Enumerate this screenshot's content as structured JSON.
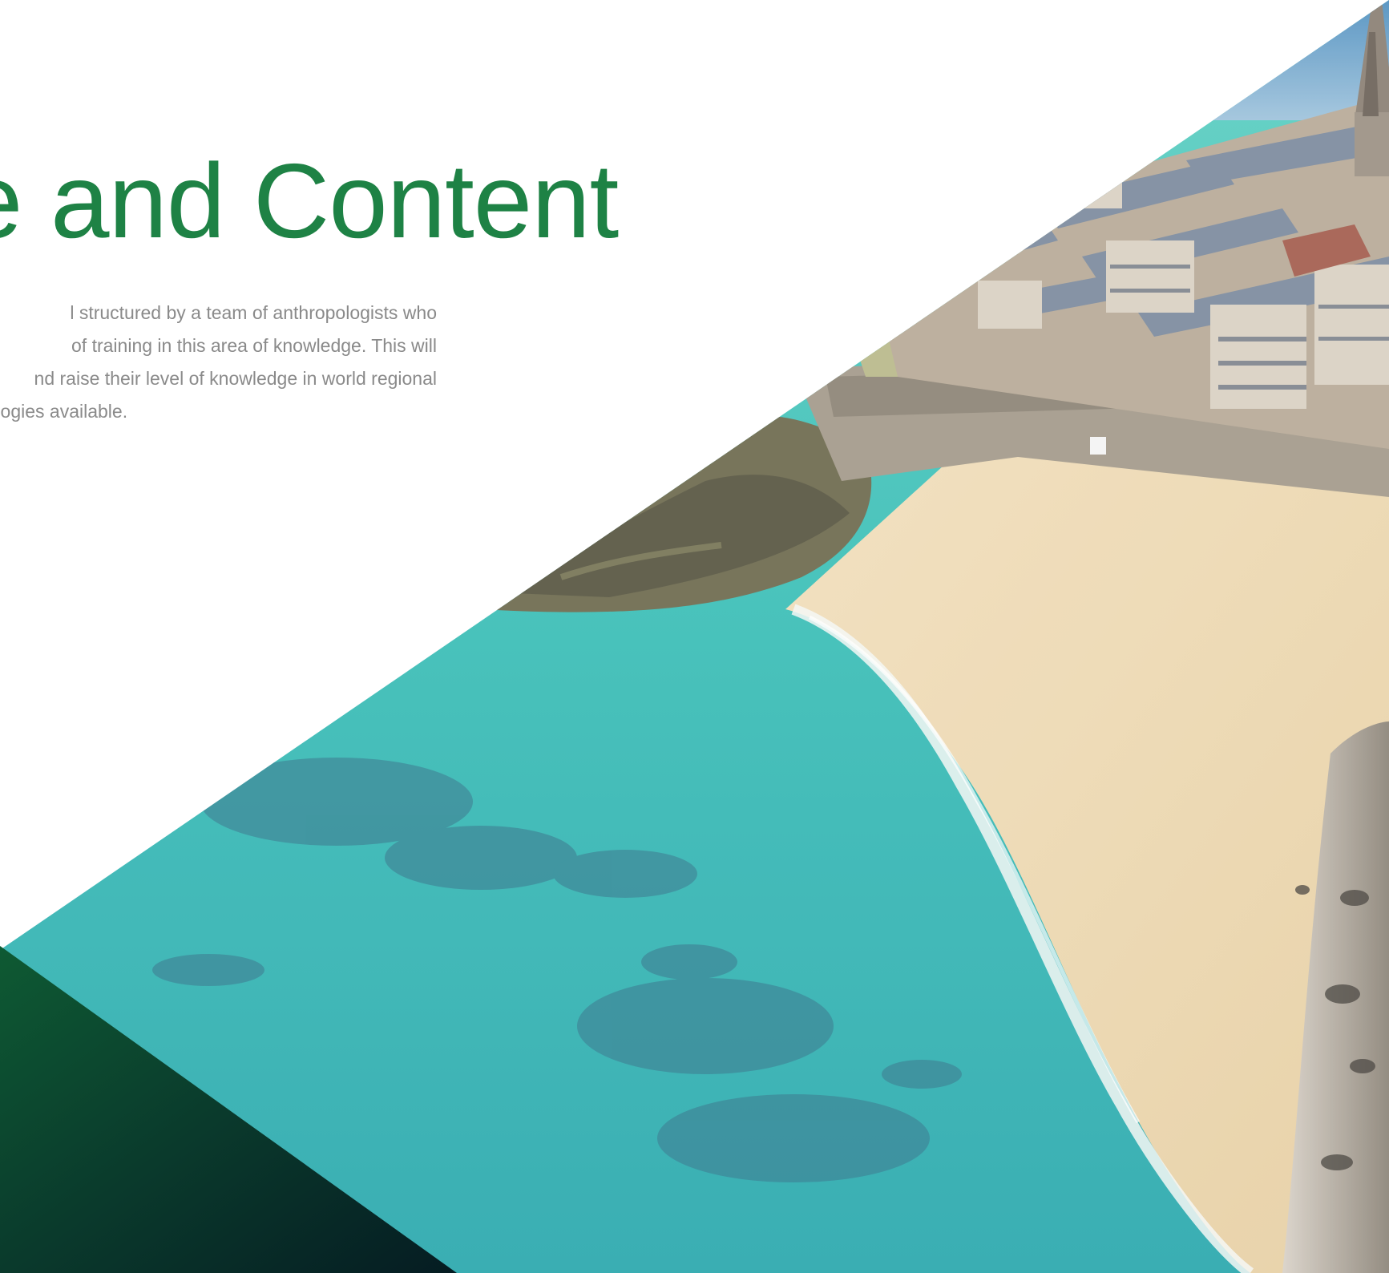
{
  "section": {
    "heading": "re and Content",
    "body_lines": [
      "l structured by a team of anthropologists who",
      "of training in this area of knowledge. This will",
      "nd raise their level of knowledge in world regional",
      "tional technologies available."
    ]
  },
  "image": {
    "subject": "aerial view of walled coastal town with sandy beach and turquoise sea"
  },
  "colors": {
    "heading": "#1e8245",
    "body_text": "#8a8a8a",
    "background": "#ffffff",
    "sea": "#3fc0b8",
    "sand": "#ecd9b2",
    "stone": "#8f8679",
    "roofs": "#7c8a9e",
    "dark_green_corner": "#0b3b2a"
  }
}
